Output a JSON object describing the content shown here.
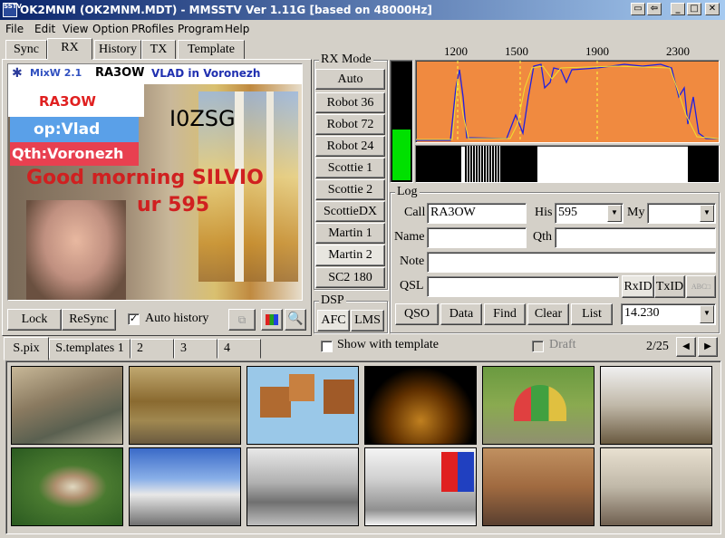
{
  "window": {
    "title": "OK2MNM (OK2MNM.MDT) - MMSSTV Ver 1.11G [based on 48000Hz]",
    "app_icon": "SSTV"
  },
  "menu": [
    "File",
    "Edit",
    "View",
    "Option",
    "PRofiles",
    "Program",
    "Help"
  ],
  "tabs_top": [
    "Sync",
    "RX",
    "History",
    "TX",
    "Template"
  ],
  "rx_image": {
    "banner_left": "MixW 2.1",
    "banner_mid": "RA3OW",
    "banner_right": "VLAD in Voronezh",
    "call": "RA3OW",
    "op": "op:Vlad",
    "qth": "Qth:Voronezh",
    "callsign": "I0ZSG",
    "line1": "Good morning SILVIO",
    "line2": "ur 595"
  },
  "rx_mode": {
    "title": "RX Mode",
    "modes": [
      "Auto",
      "Robot 36",
      "Robot 72",
      "Robot 24",
      "Scottie 1",
      "Scottie 2",
      "ScottieDX",
      "Martin 1",
      "Martin 2",
      "SC2 180"
    ],
    "selected": "Martin 2"
  },
  "dsp": {
    "title": "DSP",
    "afc": "AFC",
    "lms": "LMS"
  },
  "spectrum": {
    "ticks": [
      "1200",
      "1500",
      "1900",
      "2300"
    ]
  },
  "bottom_controls": {
    "lock": "Lock",
    "resync": "ReSync",
    "auto_history": "Auto history",
    "auto_history_checked": true
  },
  "log": {
    "title": "Log",
    "call_label": "Call",
    "call": "RA3OW",
    "his_label": "His",
    "his": "595",
    "my_label": "My",
    "my": "",
    "name_label": "Name",
    "name": "",
    "qth_label": "Qth",
    "qth": "",
    "note_label": "Note",
    "note": "",
    "qsl_label": "QSL",
    "qsl": "",
    "rxid": "RxID",
    "txid": "TxID",
    "btn_qso": "QSO",
    "btn_data": "Data",
    "btn_find": "Find",
    "btn_clear": "Clear",
    "btn_list": "List",
    "freq": "14.230"
  },
  "pix_tabs": [
    "S.pix",
    "S.templates 1",
    "2",
    "3",
    "4"
  ],
  "show_template": "Show with template",
  "draft": "Draft",
  "page_counter": "2/25",
  "colors": {
    "spectrum_bg": "#f08a40",
    "waterfall": "#000000",
    "level": "#00e000"
  }
}
